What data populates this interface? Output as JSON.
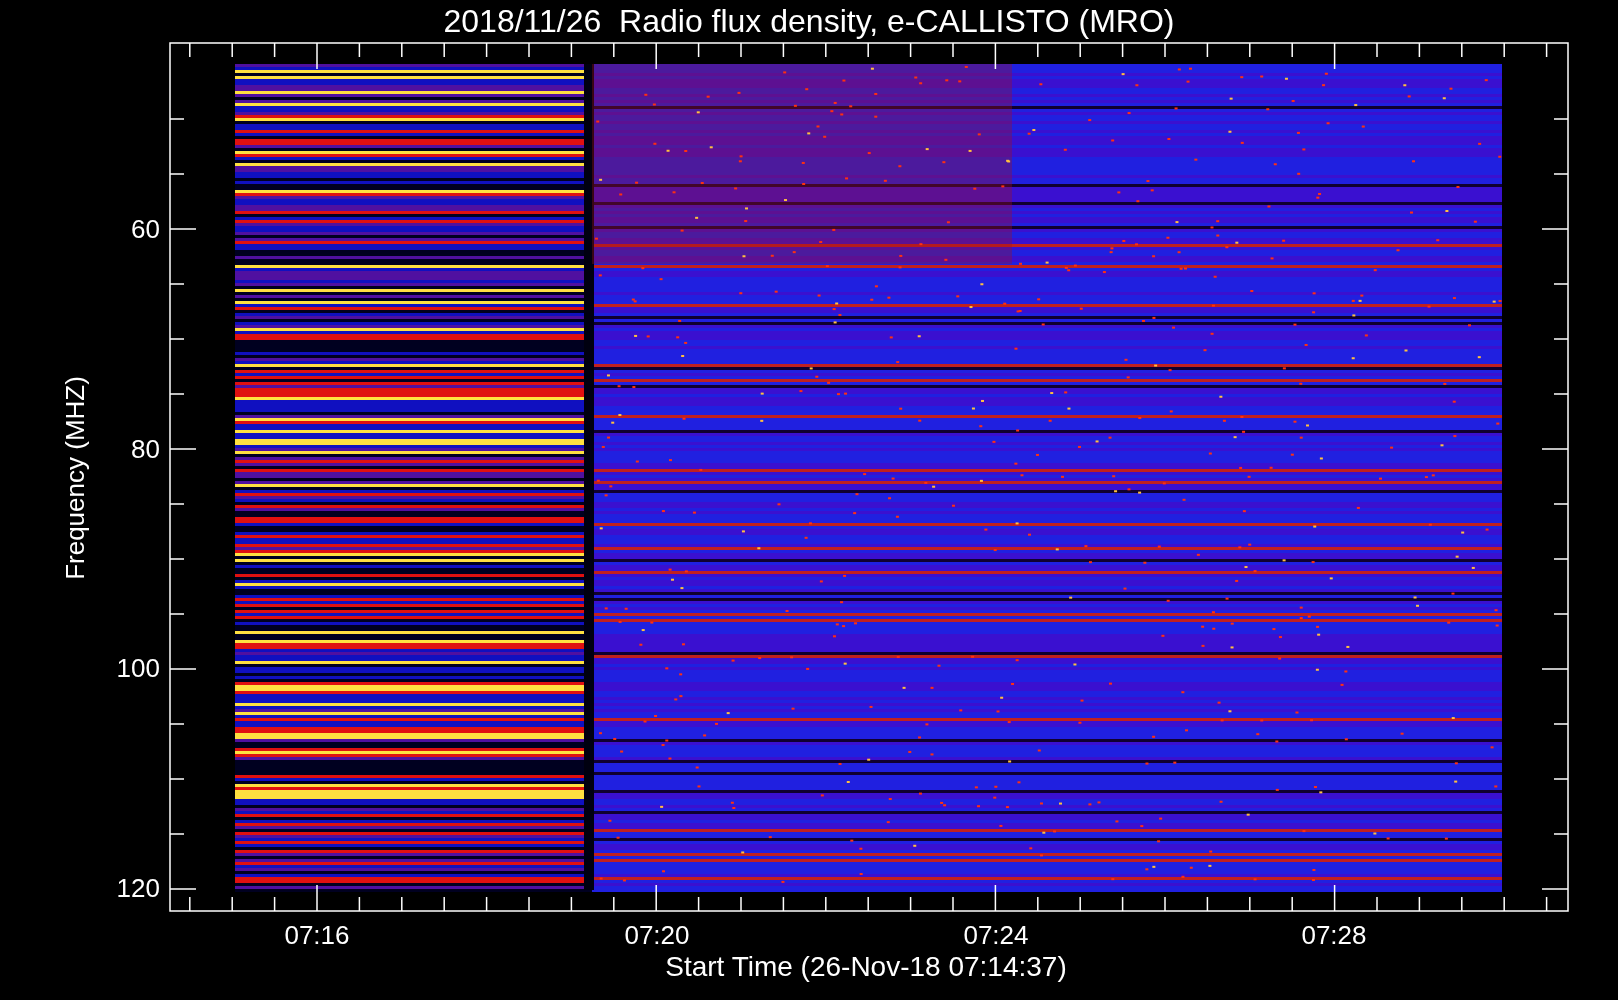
{
  "title": "2018/11/26  Radio flux density, e-CALLISTO (MRO)",
  "ylabel": "Frequency (MHZ)",
  "xlabel": "Start Time (26-Nov-18 07:14:37)",
  "yticks": [
    "60",
    "80",
    "100",
    "120"
  ],
  "xticks": [
    "07:16",
    "07:20",
    "07:24",
    "07:28"
  ]
}
